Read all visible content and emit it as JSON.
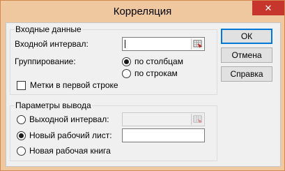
{
  "window": {
    "title": "Корреляция",
    "close_symbol": "✕"
  },
  "input_group": {
    "title": "Входные данные",
    "input_range_label": "Входной интервал:",
    "input_range_value": "",
    "grouping_label": "Группирование:",
    "grouping_options": [
      "по столбцам",
      "по строкам"
    ],
    "grouping_selected": "по столбцам",
    "labels_first_row_label": "Метки в первой строке",
    "labels_first_row_checked": false
  },
  "output_group": {
    "title": "Параметры вывода",
    "options": [
      "Выходной интервал:",
      "Новый рабочий лист:",
      "Новая рабочая книга"
    ],
    "selected": "Новый рабочий лист:",
    "output_range_value": "",
    "new_sheet_value": ""
  },
  "buttons": {
    "ok": "ОК",
    "cancel": "Отмена",
    "help": "Справка"
  },
  "colors": {
    "accent": "#0078d7",
    "titlebar": "#f0c8a0",
    "close": "#c7362c"
  },
  "icons": [
    "close-icon",
    "collapse-dialog-icon"
  ]
}
